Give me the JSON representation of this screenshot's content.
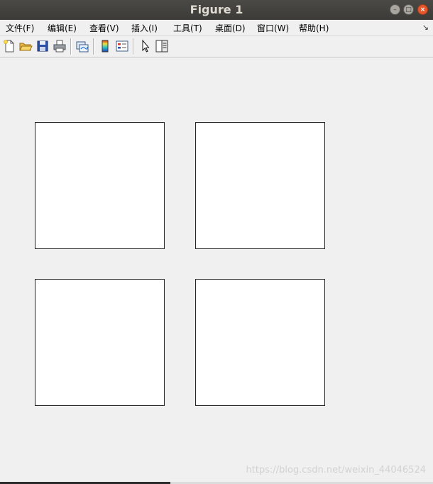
{
  "window": {
    "title": "Figure 1"
  },
  "menu": {
    "items": [
      "文件(F)",
      "编辑(E)",
      "查看(V)",
      "插入(I)",
      "工具(T)",
      "桌面(D)",
      "窗口(W)",
      "帮助(H)"
    ],
    "overflow_arrow": "↘"
  },
  "toolbar": {
    "icons": [
      "new-figure-icon",
      "open-file-icon",
      "save-icon",
      "print-icon",
      "link-plot-icon",
      "colorbar-icon",
      "legend-icon",
      "pointer-icon",
      "property-editor-icon"
    ]
  },
  "axes_count": 4,
  "watermark": "https://blog.csdn.net/weixin_44046524",
  "colors": {
    "titlebar": "#3c3b37",
    "close_button": "#e6572b",
    "background": "#f0f0f0"
  }
}
